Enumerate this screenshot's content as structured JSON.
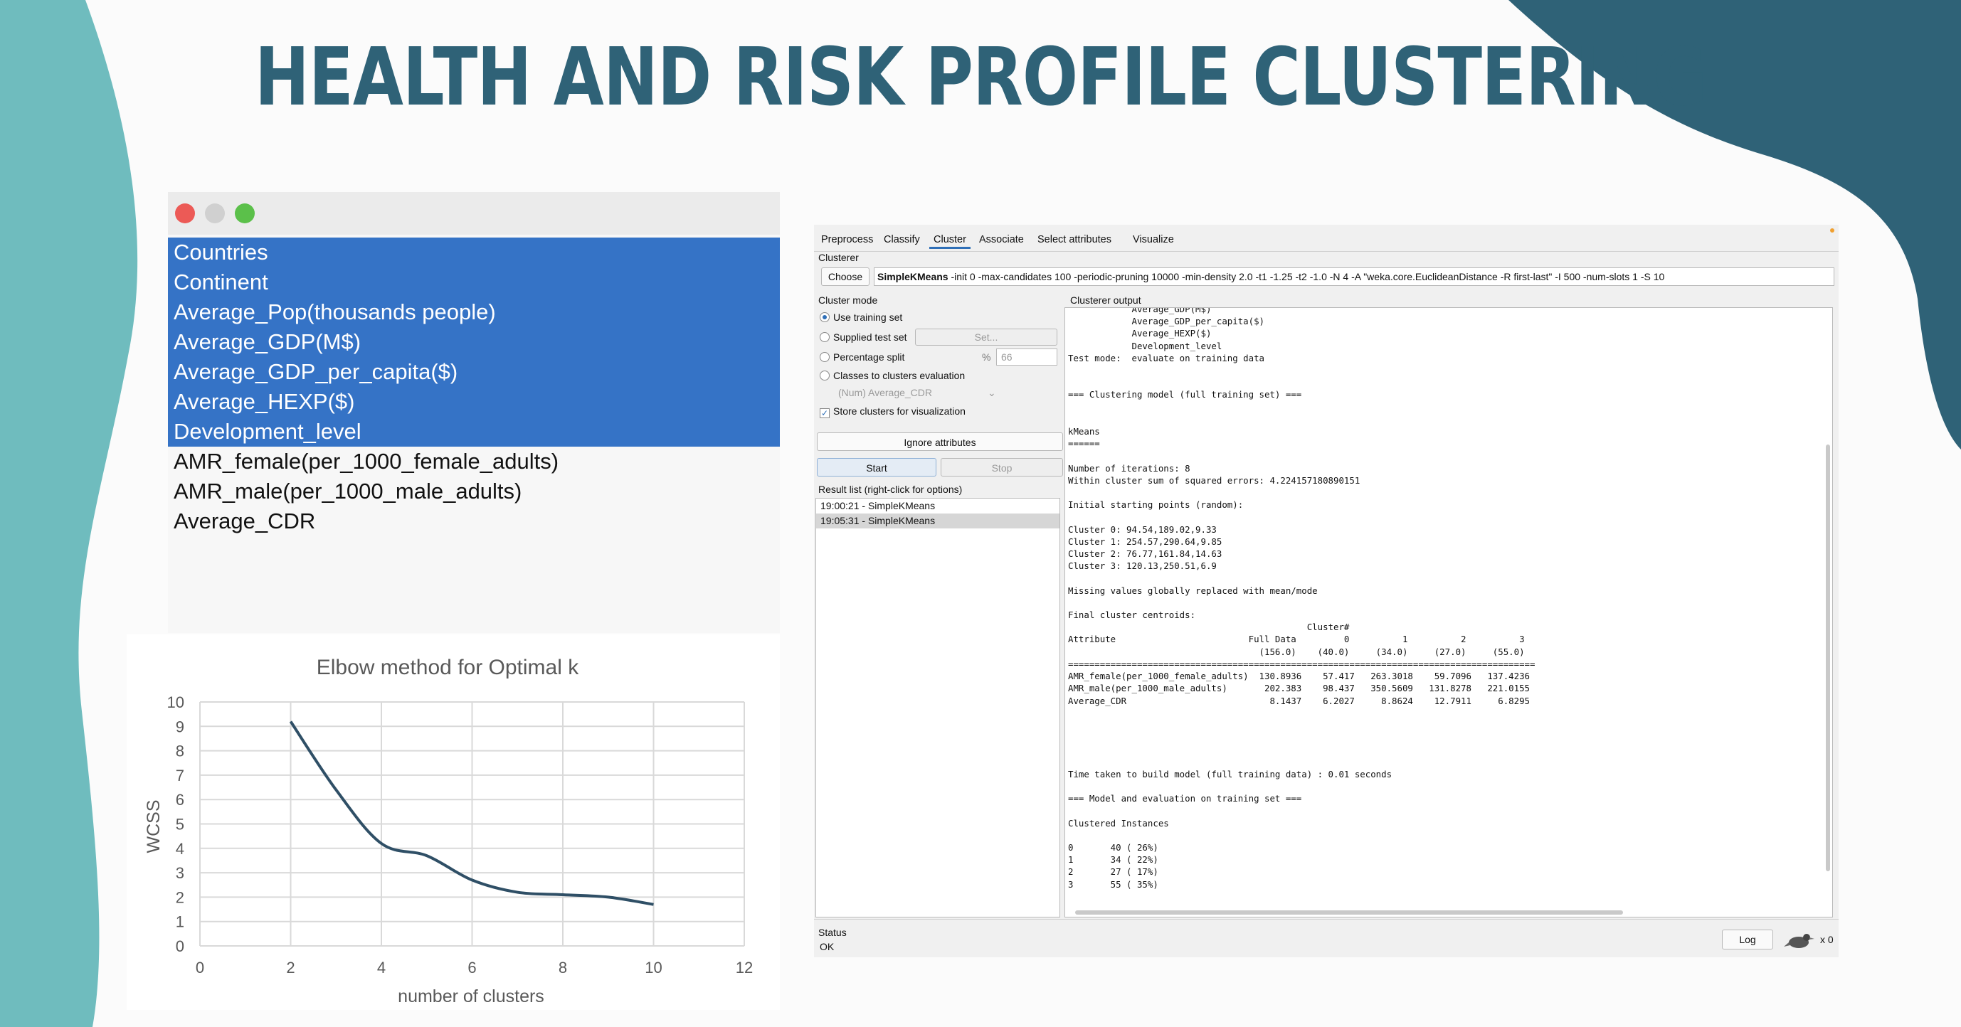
{
  "title": "HEALTH AND RISK PROFILE CLUSTERING",
  "colors": {
    "accent_dark": "#2f6277",
    "accent_teal": "#6fbcbe",
    "selection_blue": "#3573c6"
  },
  "attribute_list": {
    "window_buttons": [
      "close",
      "minimize",
      "maximize"
    ],
    "items": [
      {
        "label": "Countries",
        "selected": true
      },
      {
        "label": "Continent",
        "selected": true
      },
      {
        "label": "Average_Pop(thousands people)",
        "selected": true
      },
      {
        "label": "Average_GDP(M$)",
        "selected": true
      },
      {
        "label": "Average_GDP_per_capita($)",
        "selected": true
      },
      {
        "label": "Average_HEXP($)",
        "selected": true
      },
      {
        "label": "Development_level",
        "selected": true
      },
      {
        "label": "AMR_female(per_1000_female_adults)",
        "selected": false
      },
      {
        "label": "AMR_male(per_1000_male_adults)",
        "selected": false
      },
      {
        "label": "Average_CDR",
        "selected": false
      }
    ]
  },
  "chart_data": {
    "type": "line",
    "title": "Elbow method for Optimal k",
    "xlabel": "number of clusters",
    "ylabel": "WCSS",
    "x": [
      2,
      3,
      4,
      5,
      6,
      7,
      8,
      9,
      10
    ],
    "y": [
      9.2,
      6.4,
      4.2,
      3.7,
      2.7,
      2.2,
      2.1,
      2.0,
      1.7
    ],
    "xlim": [
      0,
      12
    ],
    "ylim": [
      0,
      10
    ],
    "xticks": [
      "0",
      "2",
      "4",
      "6",
      "8",
      "10",
      "12"
    ],
    "yticks": [
      "0",
      "1",
      "2",
      "3",
      "4",
      "5",
      "6",
      "7",
      "8",
      "9",
      "10"
    ],
    "grid": true,
    "line_color": "#2f4f66"
  },
  "weka": {
    "tabs": [
      "Preprocess",
      "Classify",
      "Cluster",
      "Associate",
      "Select attributes",
      "Visualize"
    ],
    "active_tab": "Cluster",
    "clusterer_label": "Clusterer",
    "choose_label": "Choose",
    "clusterer_name": "SimpleKMeans",
    "clusterer_options": " -init 0 -max-candidates 100 -periodic-pruning 10000 -min-density 2.0 -t1 -1.25 -t2 -1.0 -N 4 -A \"weka.core.EuclideanDistance -R first-last\" -I 500 -num-slots 1 -S 10",
    "cluster_mode_label": "Cluster mode",
    "modes": {
      "use_training": "Use training set",
      "supplied_test": "Supplied test set",
      "set_button": "Set...",
      "percentage_split": "Percentage split",
      "percent_sign": "%",
      "percent_value": "66",
      "classes_to_clusters": "Classes to clusters evaluation",
      "class_attribute": "(Num) Average_CDR",
      "store_clusters": "Store clusters for visualization"
    },
    "ignore_attributes_label": "Ignore attributes",
    "start_label": "Start",
    "stop_label": "Stop",
    "result_list_label": "Result list (right-click for options)",
    "result_items": [
      "19:00:21 - SimpleKMeans",
      "19:05:31 - SimpleKMeans"
    ],
    "output_label": "Clusterer output",
    "output_text": "            Average_GDP(M$)\n            Average_GDP_per_capita($)\n            Average_HEXP($)\n            Development_level\nTest mode:  evaluate on training data\n\n\n=== Clustering model (full training set) ===\n\n\nkMeans\n======\n\nNumber of iterations: 8\nWithin cluster sum of squared errors: 4.224157180890151\n\nInitial starting points (random):\n\nCluster 0: 94.54,189.02,9.33\nCluster 1: 254.57,290.64,9.85\nCluster 2: 76.77,161.84,14.63\nCluster 3: 120.13,250.51,6.9\n\nMissing values globally replaced with mean/mode\n\nFinal cluster centroids:\n                                             Cluster#\nAttribute                         Full Data         0          1          2          3\n                                    (156.0)    (40.0)     (34.0)     (27.0)     (55.0)\n========================================================================================\nAMR_female(per_1000_female_adults)  130.8936    57.417   263.3018    59.7096   137.4236\nAMR_male(per_1000_male_adults)       202.383    98.437   350.5609   131.8278   221.0155\nAverage_CDR                           8.1437    6.2027     8.8624    12.7911     6.8295\n\n\n\n\n\nTime taken to build model (full training data) : 0.01 seconds\n\n=== Model and evaluation on training set ===\n\nClustered Instances\n\n0       40 ( 26%)\n1       34 ( 22%)\n2       27 ( 17%)\n3       55 ( 35%)",
    "status_label": "Status",
    "status_text": "OK",
    "log_label": "Log",
    "worker_count": "x 0"
  }
}
